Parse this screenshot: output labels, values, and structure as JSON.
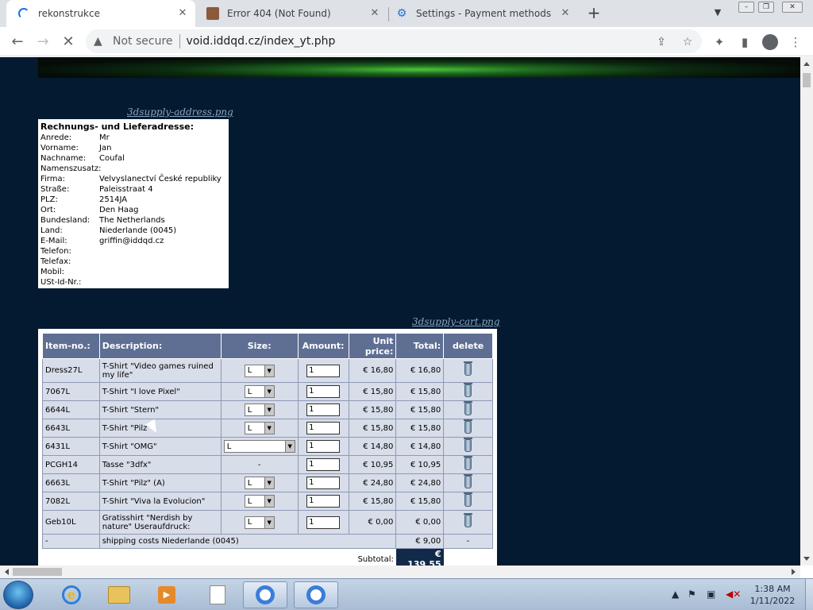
{
  "browser": {
    "tabs": [
      {
        "title": "rekonstrukce",
        "active": true
      },
      {
        "title": "Error 404 (Not Found)",
        "active": false
      },
      {
        "title": "Settings - Payment methods",
        "active": false
      }
    ],
    "new_tab": "+",
    "security_label": "Not secure",
    "url": "void.iddqd.cz/index_yt.php"
  },
  "page": {
    "address_image_link": "3dsupply-address.png",
    "cart_image_link": "3dsupply-cart.png",
    "address": {
      "title": "Rechnungs- und Lieferadresse:",
      "fields": [
        {
          "label": "Anrede:",
          "value": "Mr"
        },
        {
          "label": "Vorname:",
          "value": "Jan"
        },
        {
          "label": "Nachname:",
          "value": "Coufal"
        },
        {
          "label": "Namenszusatz:",
          "value": ""
        },
        {
          "label": "Firma:",
          "value": "Velvyslanectví České republiky"
        },
        {
          "label": "Straße:",
          "value": "Paleisstraat 4"
        },
        {
          "label": "PLZ:",
          "value": "2514JA"
        },
        {
          "label": "Ort:",
          "value": "Den Haag"
        },
        {
          "label": "Bundesland:",
          "value": "The Netherlands"
        },
        {
          "label": "Land:",
          "value": "Niederlande (0045)"
        },
        {
          "label": "E-Mail:",
          "value": "griffin@iddqd.cz"
        },
        {
          "label": "Telefon:",
          "value": ""
        },
        {
          "label": "Telefax:",
          "value": ""
        },
        {
          "label": "Mobil:",
          "value": ""
        },
        {
          "label": "USt-Id-Nr.:",
          "value": ""
        }
      ]
    },
    "cart": {
      "headers": {
        "item_no": "Item-no.:",
        "description": "Description:",
        "size": "Size:",
        "amount": "Amount:",
        "unit_price_1": "Unit",
        "unit_price_2": "price:",
        "total": "Total:",
        "delete": "delete"
      },
      "rows": [
        {
          "item_no": "Dress27L",
          "description": "T-Shirt \"Video games ruined my life\"",
          "size": "L",
          "amount": "1",
          "unit_price": "€ 16,80",
          "total": "€ 16,80"
        },
        {
          "item_no": "7067L",
          "description": "T-Shirt \"I love Pixel\"",
          "size": "L",
          "amount": "1",
          "unit_price": "€ 15,80",
          "total": "€ 15,80"
        },
        {
          "item_no": "6644L",
          "description": "T-Shirt \"Stern\"",
          "size": "L",
          "amount": "1",
          "unit_price": "€ 15,80",
          "total": "€ 15,80"
        },
        {
          "item_no": "6643L",
          "description": "T-Shirt \"Pilz\"",
          "size": "L",
          "amount": "1",
          "unit_price": "€ 15,80",
          "total": "€ 15,80"
        },
        {
          "item_no": "6431L",
          "description": "T-Shirt \"OMG\"",
          "size": "L",
          "amount": "1",
          "unit_price": "€ 14,80",
          "total": "€ 14,80"
        },
        {
          "item_no": "PCGH14",
          "description": "Tasse \"3dfx\"",
          "size": "-",
          "amount": "1",
          "unit_price": "€ 10,95",
          "total": "€ 10,95"
        },
        {
          "item_no": "6663L",
          "description": "T-Shirt \"Pilz\" (A)",
          "size": "L",
          "amount": "1",
          "unit_price": "€ 24,80",
          "total": "€ 24,80"
        },
        {
          "item_no": "7082L",
          "description": "T-Shirt \"Viva la Evolucion\"",
          "size": "L",
          "amount": "1",
          "unit_price": "€ 15,80",
          "total": "€ 15,80"
        },
        {
          "item_no": "Geb10L",
          "description": "Gratisshirt \"Nerdish by nature\" Useraufdruck:",
          "size": "L",
          "amount": "1",
          "unit_price": "€ 0,00",
          "total": "€ 0,00"
        }
      ],
      "shipping": {
        "item_no": "-",
        "description": "shipping costs Niederlande (0045)",
        "total": "€ 9,00",
        "delete": "-"
      },
      "subtotal_label": "Subtotal:",
      "subtotal_value": "€ 139,55"
    }
  },
  "taskbar": {
    "time": "1:38 AM",
    "date": "1/11/2022"
  }
}
